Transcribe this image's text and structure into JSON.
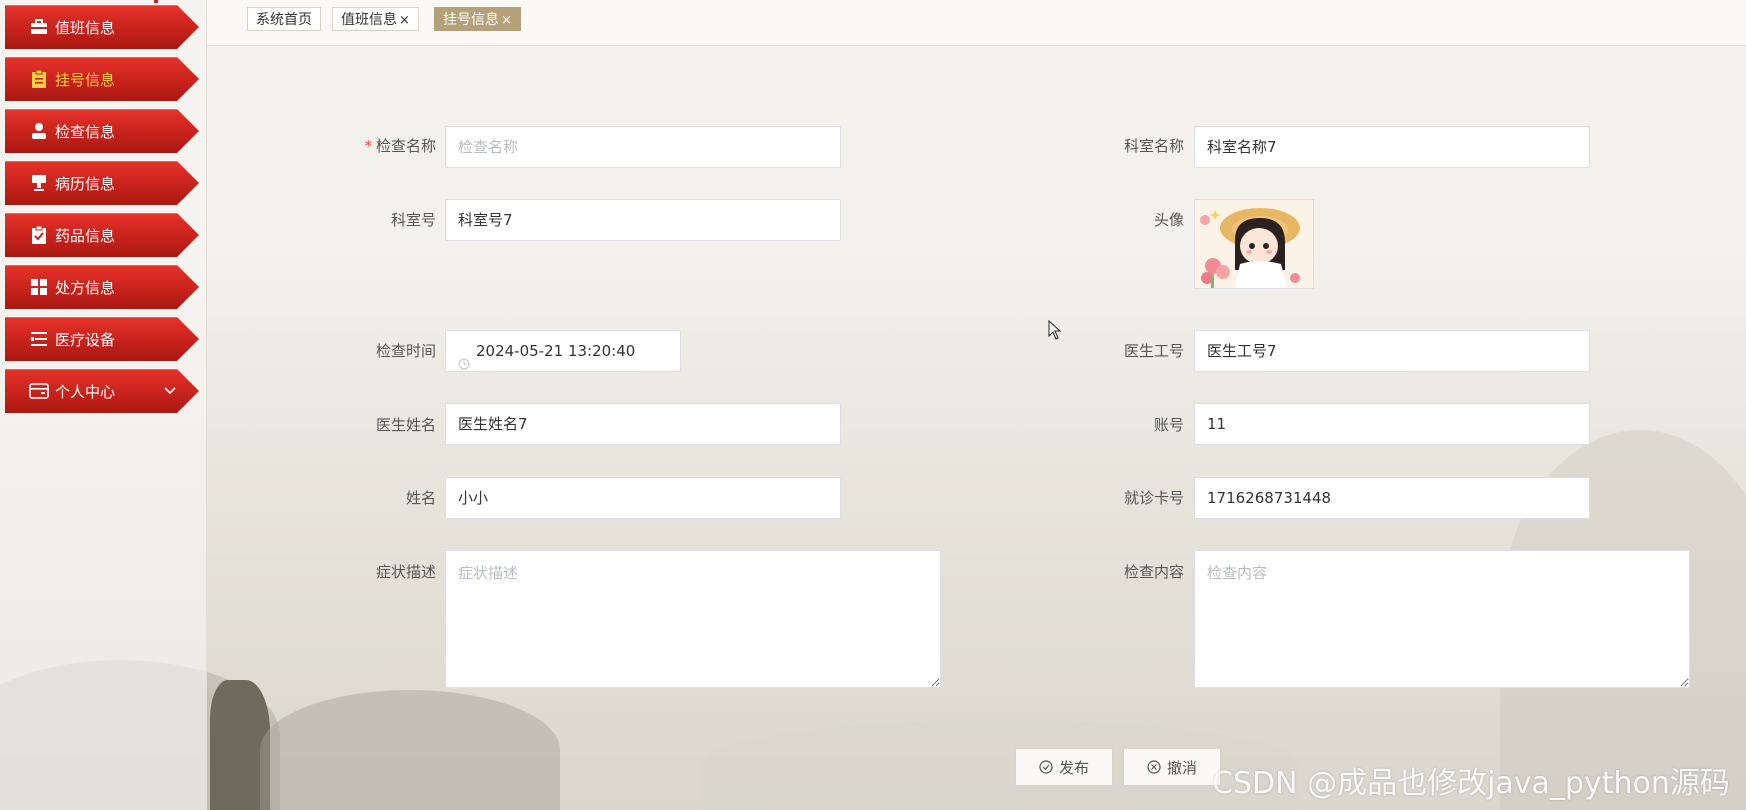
{
  "sidebar": {
    "items": [
      {
        "label": "值班信息",
        "icon": "briefcase-icon"
      },
      {
        "label": "挂号信息",
        "icon": "clipboard-icon",
        "active": true
      },
      {
        "label": "检查信息",
        "icon": "user-icon"
      },
      {
        "label": "病历信息",
        "icon": "stamp-icon"
      },
      {
        "label": "药品信息",
        "icon": "clipboard-check-icon"
      },
      {
        "label": "处方信息",
        "icon": "grid-icon"
      },
      {
        "label": "医疗设备",
        "icon": "list-icon"
      },
      {
        "label": "个人中心",
        "icon": "wallet-icon",
        "has_submenu": true
      }
    ],
    "active_color": "#ffd23f",
    "item_color": "#d42a22"
  },
  "tabs": [
    {
      "label": "系统首页",
      "closable": false
    },
    {
      "label": "值班信息",
      "closable": true
    },
    {
      "label": "挂号信息",
      "closable": true,
      "active": true
    }
  ],
  "tab_close_glyph": "×",
  "form": {
    "check_name": {
      "label": "检查名称",
      "required": true,
      "value": "",
      "placeholder": "检查名称"
    },
    "dept_name": {
      "label": "科室名称",
      "value": "科室名称7"
    },
    "dept_no": {
      "label": "科室号",
      "value": "科室号7"
    },
    "avatar": {
      "label": "头像"
    },
    "check_time": {
      "label": "检查时间",
      "value": "2024-05-21 13:20:40"
    },
    "doctor_id": {
      "label": "医生工号",
      "value": "医生工号7"
    },
    "doctor_name": {
      "label": "医生姓名",
      "value": "医生姓名7"
    },
    "account": {
      "label": "账号",
      "value": "11"
    },
    "patient_name": {
      "label": "姓名",
      "value": "小小"
    },
    "card_no": {
      "label": "就诊卡号",
      "value": "1716268731448"
    },
    "symptom": {
      "label": "症状描述",
      "value": "",
      "placeholder": "症状描述"
    },
    "check_content": {
      "label": "检查内容",
      "value": "",
      "placeholder": "检查内容"
    }
  },
  "buttons": {
    "submit": "发布",
    "cancel": "撤消"
  },
  "watermark": "CSDN @成品也修改java_python源码",
  "colors": {
    "tab_active": "#b5a079",
    "required": "#e5463a"
  }
}
